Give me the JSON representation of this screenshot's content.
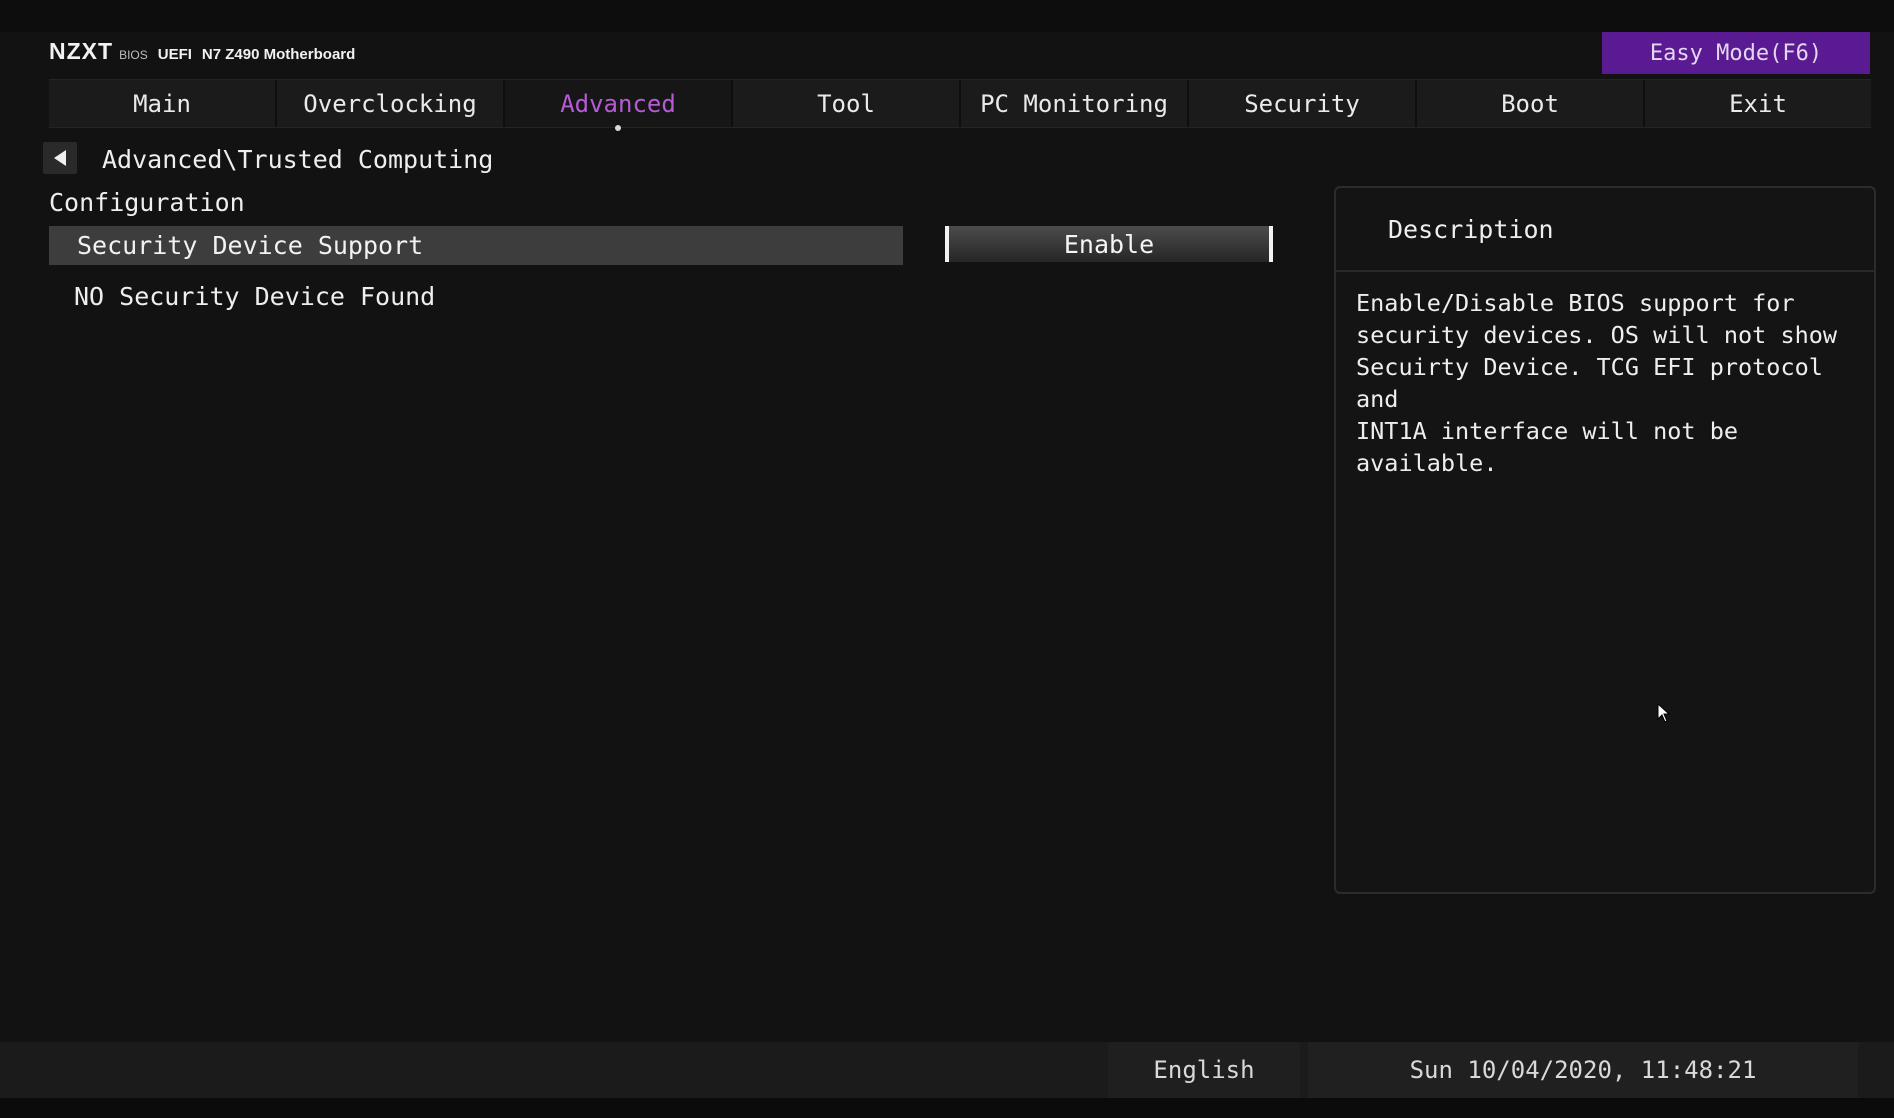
{
  "header": {
    "brand_logo": "NZXT",
    "brand_bios": "BIOS",
    "brand_uefi": "UEFI",
    "brand_model": "N7 Z490 Motherboard",
    "easy_mode_label": "Easy Mode(F6)",
    "easy_mode_color": "#5a1a91"
  },
  "tabs": [
    {
      "label": "Main",
      "active": false
    },
    {
      "label": "Overclocking",
      "active": false
    },
    {
      "label": "Advanced",
      "active": true
    },
    {
      "label": "Tool",
      "active": false
    },
    {
      "label": "PC Monitoring",
      "active": false
    },
    {
      "label": "Security",
      "active": false
    },
    {
      "label": "Boot",
      "active": false
    },
    {
      "label": "Exit",
      "active": false
    }
  ],
  "active_tab_color": "#b65ad6",
  "breadcrumb": {
    "path": "Advanced\\Trusted Computing",
    "back_icon": "triangle-left-icon"
  },
  "content": {
    "section_heading": "Configuration",
    "setting": {
      "label": "Security Device Support",
      "value": "Enable"
    },
    "info_line": "NO Security Device Found"
  },
  "description": {
    "title": "Description",
    "body": "Enable/Disable BIOS support for\nsecurity devices. OS will not show\nSecuirty Device. TCG EFI protocol and\nINT1A interface will not be available."
  },
  "footer": {
    "language": "English",
    "datetime": "Sun 10/04/2020, 11:48:21"
  },
  "icons": {
    "mouse_cursor": "mouse-pointer-icon"
  }
}
